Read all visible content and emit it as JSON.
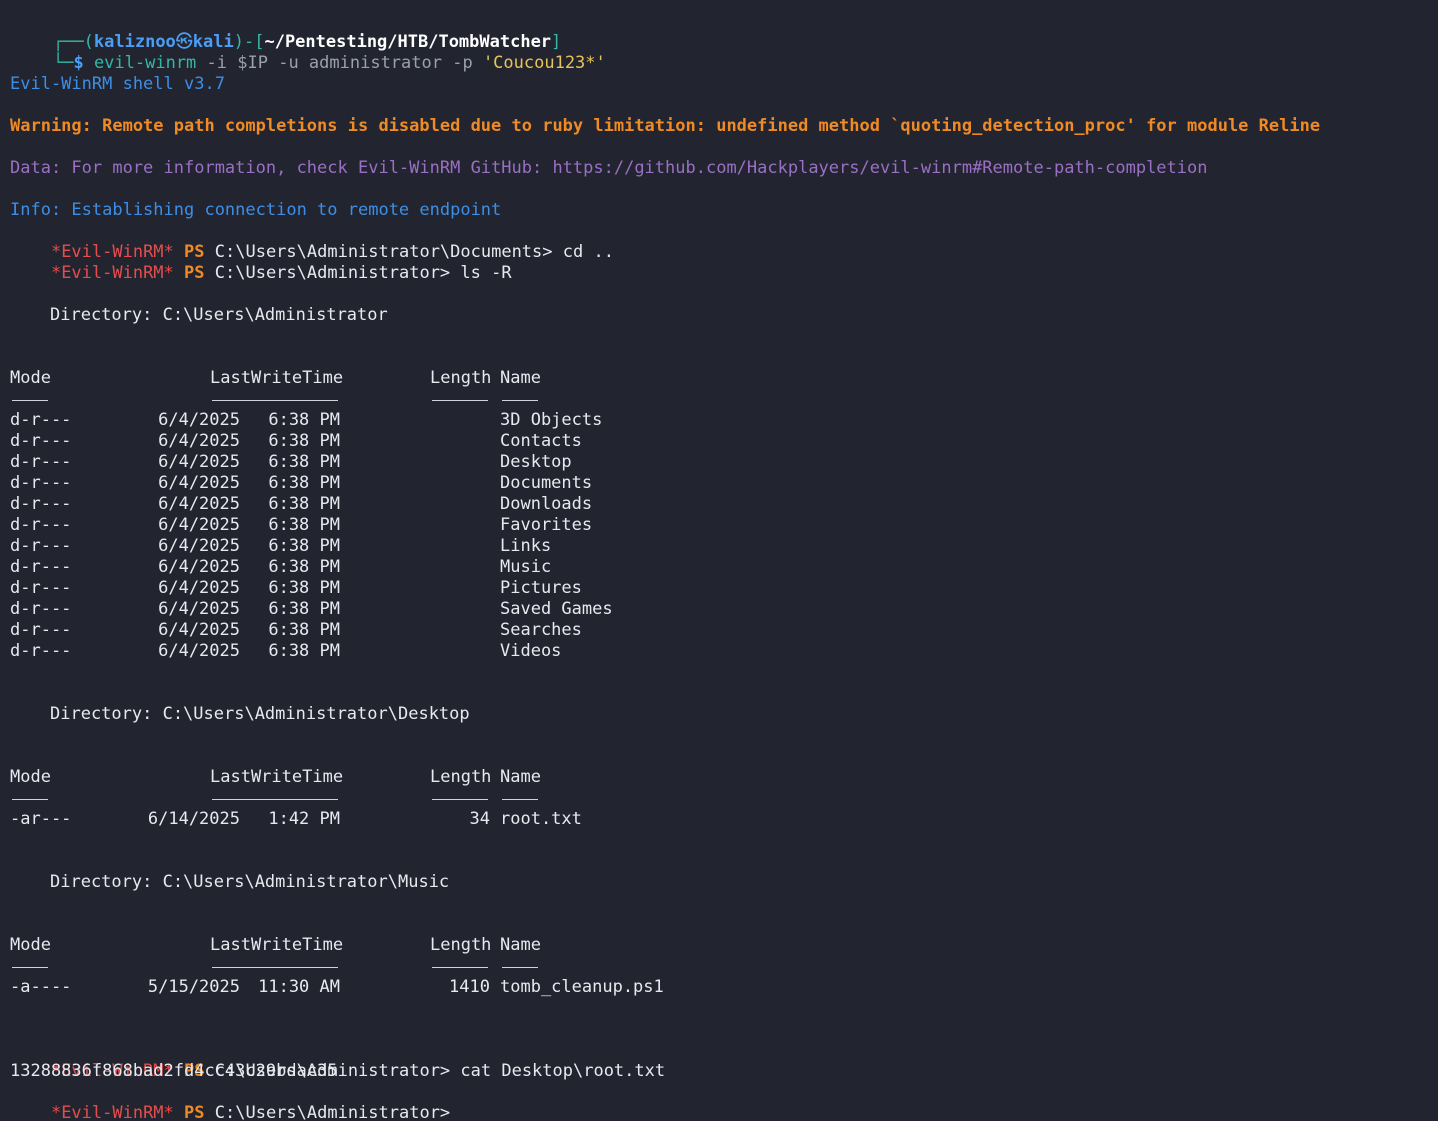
{
  "prompt": {
    "frame_top": "┌──(",
    "user": "kaliznoo",
    "at_symbol": "㉿",
    "host": "kali",
    "sep": ")-[",
    "cwd": "~/Pentesting/HTB/TombWatcher",
    "close": "]",
    "frame_bottom": "└─",
    "dollar": "$",
    "command": "evil-winrm",
    "args": [
      {
        "text": " -i ",
        "kind": "dim"
      },
      {
        "text": "$IP",
        "kind": "dim"
      },
      {
        "text": " -u ",
        "kind": "dim"
      },
      {
        "text": "administrator",
        "kind": "dim"
      },
      {
        "text": " -p ",
        "kind": "dim"
      },
      {
        "text": "'Coucou123*'",
        "kind": "str"
      }
    ]
  },
  "messages": {
    "shell": "Evil-WinRM shell v3.7",
    "warning": "Warning: Remote path completions is disabled due to ruby limitation: undefined method `quoting_detection_proc' for module Reline",
    "data": "Data: For more information, check Evil-WinRM GitHub: https://github.com/Hackplayers/evil-winrm#Remote-path-completion",
    "info": "Info: Establishing connection to remote endpoint"
  },
  "ps_prompt": {
    "tag": "*Evil-WinRM*",
    "ps": "PS"
  },
  "commands": [
    {
      "path": "C:\\Users\\Administrator\\Documents>",
      "cmd": " cd .."
    },
    {
      "path": "C:\\Users\\Administrator>",
      "cmd": " ls -R"
    }
  ],
  "table_headers": {
    "mode": "Mode",
    "time": "LastWriteTime",
    "length": "Length",
    "name": "Name"
  },
  "directories": [
    {
      "label": "Directory: C:\\Users\\Administrator",
      "rows": [
        {
          "mode": "d-r---",
          "date": "6/4/2025",
          "time": "6:38 PM",
          "length": "",
          "name": "3D Objects"
        },
        {
          "mode": "d-r---",
          "date": "6/4/2025",
          "time": "6:38 PM",
          "length": "",
          "name": "Contacts"
        },
        {
          "mode": "d-r---",
          "date": "6/4/2025",
          "time": "6:38 PM",
          "length": "",
          "name": "Desktop"
        },
        {
          "mode": "d-r---",
          "date": "6/4/2025",
          "time": "6:38 PM",
          "length": "",
          "name": "Documents"
        },
        {
          "mode": "d-r---",
          "date": "6/4/2025",
          "time": "6:38 PM",
          "length": "",
          "name": "Downloads"
        },
        {
          "mode": "d-r---",
          "date": "6/4/2025",
          "time": "6:38 PM",
          "length": "",
          "name": "Favorites"
        },
        {
          "mode": "d-r---",
          "date": "6/4/2025",
          "time": "6:38 PM",
          "length": "",
          "name": "Links"
        },
        {
          "mode": "d-r---",
          "date": "6/4/2025",
          "time": "6:38 PM",
          "length": "",
          "name": "Music"
        },
        {
          "mode": "d-r---",
          "date": "6/4/2025",
          "time": "6:38 PM",
          "length": "",
          "name": "Pictures"
        },
        {
          "mode": "d-r---",
          "date": "6/4/2025",
          "time": "6:38 PM",
          "length": "",
          "name": "Saved Games"
        },
        {
          "mode": "d-r---",
          "date": "6/4/2025",
          "time": "6:38 PM",
          "length": "",
          "name": "Searches"
        },
        {
          "mode": "d-r---",
          "date": "6/4/2025",
          "time": "6:38 PM",
          "length": "",
          "name": "Videos"
        }
      ]
    },
    {
      "label": "Directory: C:\\Users\\Administrator\\Desktop",
      "rows": [
        {
          "mode": "-ar---",
          "date": "6/14/2025",
          "time": "1:42 PM",
          "length": "34",
          "name": "root.txt"
        }
      ]
    },
    {
      "label": "Directory: C:\\Users\\Administrator\\Music",
      "rows": [
        {
          "mode": "-a----",
          "date": "5/15/2025",
          "time": "11:30 AM",
          "length": "1410",
          "name": "tomb_cleanup.ps1"
        }
      ]
    }
  ],
  "final": {
    "cat_path": "C:\\Users\\Administrator>",
    "cat_cmd": " cat Desktop\\root.txt",
    "flag": "13288836f868bad2fd4cc43c29bdac35",
    "last_path": "C:\\Users\\Administrator>"
  }
}
